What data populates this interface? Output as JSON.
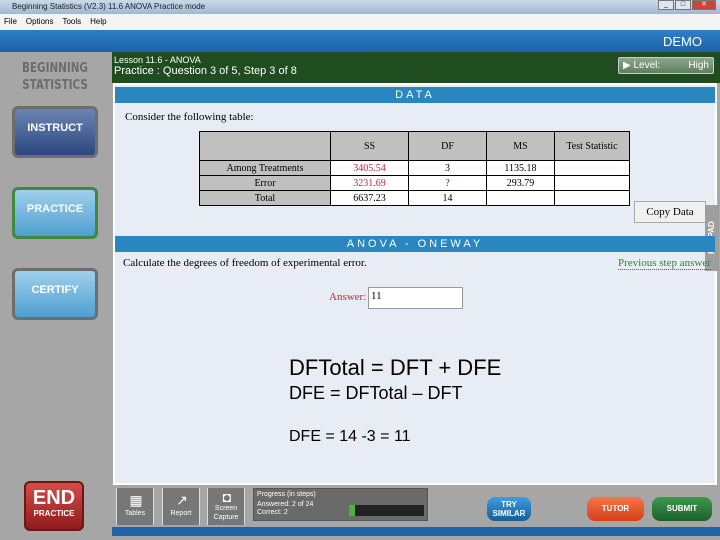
{
  "window": {
    "title": "Beginning Statistics (V2.3)   11.6 ANOVA   Practice mode"
  },
  "menu": [
    "File",
    "Options",
    "Tools",
    "Help"
  ],
  "banner": "DEMO",
  "sidebar": {
    "brand_line1": "BEGINNING",
    "brand_line2": "STATISTICS",
    "instruct": "INSTRUCT",
    "practice": "PRACTICE",
    "certify": "CERTIFY",
    "end": "END",
    "end_sub": "PRACTICE"
  },
  "header": {
    "lesson": "Lesson 11.6 - ANOVA",
    "step": "Practice : Question 3 of 5, Step 3 of 8",
    "level_label": "Level:",
    "level_value": "High"
  },
  "data_section": {
    "title": "DATA",
    "prompt": "Consider the following table:",
    "columns": [
      "",
      "SS",
      "DF",
      "MS",
      "Test Statistic"
    ],
    "rows": [
      [
        "Among Treatments",
        "3405.54",
        "3",
        "1135.18",
        ""
      ],
      [
        "Error",
        "3231.69",
        "?",
        "293.79",
        ""
      ],
      [
        "Total",
        "6637.23",
        "14",
        "",
        ""
      ]
    ],
    "copy_button": "Copy Data"
  },
  "keypad": "KEYPAD",
  "anova": {
    "title": "ANOVA - ONEWAY",
    "question": "Calculate the degrees of freedom of experimental error.",
    "previous": "Previous step answer",
    "answer_label": "Answer:",
    "answer_value": "11"
  },
  "overlay": {
    "line1": "DFTotal = DFT + DFE",
    "line2": "DFE = DFTotal – DFT",
    "line3": "DFE = 14 -3 = 11"
  },
  "toolbar": {
    "tables": "Tables",
    "report": "Report",
    "capture_1": "Screen",
    "capture_2": "Capture"
  },
  "progress": {
    "title": "Progress (in steps)",
    "answered": "Answered:  2 of 24",
    "correct": "Correct:    2",
    "fraction": 0.0833
  },
  "buttons": {
    "try_1": "TRY",
    "try_2": "SIMILAR",
    "tutor": "TUTOR",
    "submit": "SUBMIT"
  }
}
